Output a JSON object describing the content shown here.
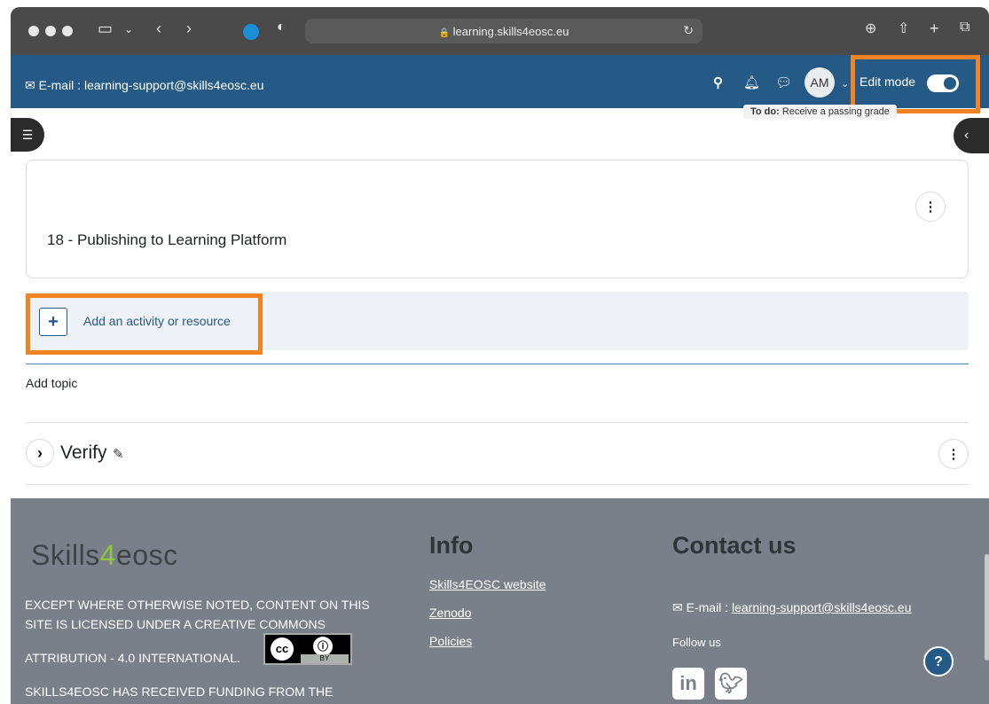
{
  "browser": {
    "url": "learning.skills4eosc.eu",
    "lock": "🔒",
    "reload": "↻",
    "icons": [
      "sidebar-icon",
      "back-icon",
      "forward-icon",
      "extension-icon",
      "shield-icon",
      "download-icon",
      "share-icon",
      "new-tab-icon",
      "tabs-icon"
    ]
  },
  "header": {
    "email_label": "E-mail : learning-support@skills4eosc.eu",
    "avatar_initials": "AM",
    "edit_mode_label": "Edit mode",
    "edit_mode_on": true
  },
  "content": {
    "todo_prefix": "To do:",
    "todo_text": "Receive a passing grade",
    "section_title": "18 - Publishing to Learning Platform",
    "add_activity_label": "Add an activity or resource",
    "add_topic_label": "Add topic",
    "verify_section_label": "Verify"
  },
  "footer": {
    "logo_a": "Skills",
    "logo_b": "4",
    "logo_c": "eosc",
    "license_line1": "EXCEPT WHERE OTHERWISE NOTED, CONTENT ON THIS",
    "license_line2": "SITE IS LICENSED UNDER A CREATIVE COMMONS",
    "license_line3": "ATTRIBUTION - 4.0 INTERNATIONAL.",
    "funding_line": "SKILLS4EOSC HAS RECEIVED FUNDING FROM THE",
    "info_heading": "Info",
    "info_links": [
      "Skills4EOSC website",
      "Zenodo",
      "Policies"
    ],
    "contact_heading": "Contact us",
    "contact_email_prefix": "E-mail : ",
    "contact_email": "learning-support@skills4eosc.eu",
    "follow_us": "Follow us",
    "cc_badge_text": "BY",
    "help_label": "?"
  },
  "colors": {
    "header_blue": "#245a85",
    "highlight_orange": "#f58220",
    "footer_gray": "#7a8089",
    "logo_green": "#8dc63f"
  }
}
